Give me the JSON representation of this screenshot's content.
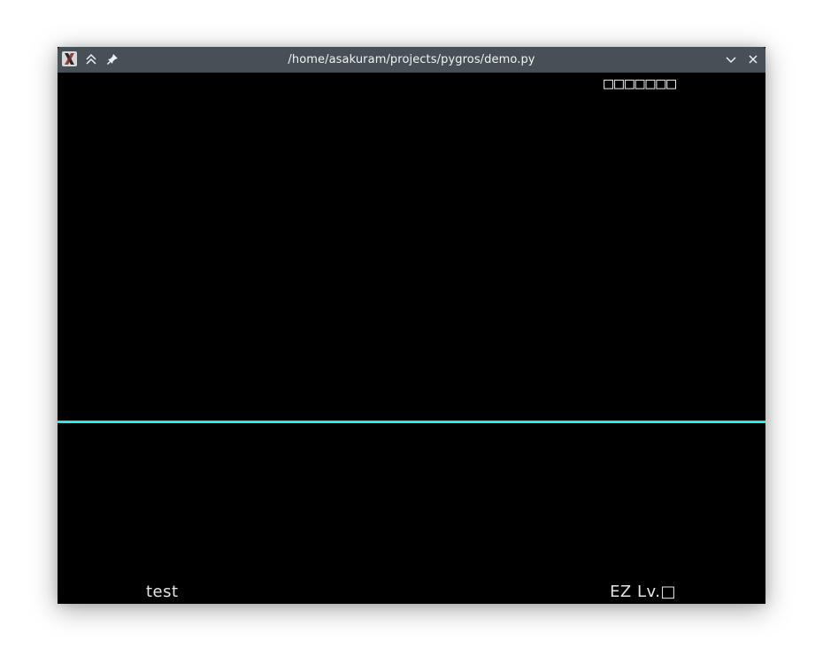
{
  "window": {
    "title": "/home/asakuram/projects/pygros/demo.py"
  },
  "titlebar_icons": {
    "app": "x-app-icon",
    "keep_above": "keep-above-icon",
    "pin": "pin-icon",
    "minimize": "chevron-down-icon",
    "close": "close-icon"
  },
  "game": {
    "score": "□□□□□□□",
    "song_name": "test",
    "difficulty": "EZ Lv.□"
  },
  "colors": {
    "titlebar": "#475057",
    "canvas": "#000000",
    "judge_line": "#2ee6e6",
    "hud_text": "#e6e6e6"
  }
}
